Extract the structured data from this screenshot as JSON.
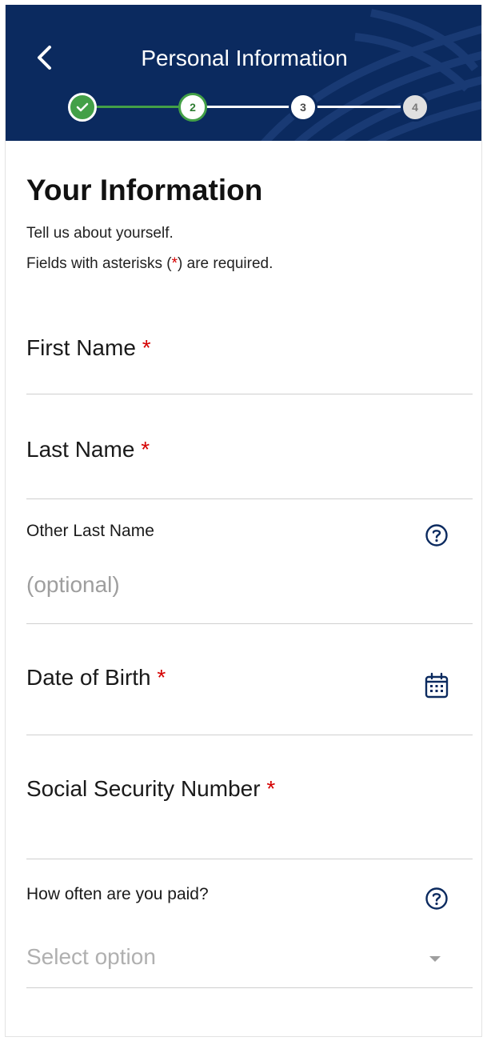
{
  "header": {
    "title": "Personal Information",
    "back_icon": "chevron-left-icon",
    "steps": [
      {
        "label": "",
        "state": "done",
        "icon": "check-icon"
      },
      {
        "label": "2",
        "state": "current"
      },
      {
        "label": "3",
        "state": "upcoming"
      },
      {
        "label": "4",
        "state": "upcoming"
      }
    ],
    "colors": {
      "background": "#0b2a5f",
      "complete": "#43a047"
    }
  },
  "section": {
    "title": "Your Information",
    "intro_line1": "Tell us about yourself.",
    "intro_line2_prefix": "Fields with asterisks (",
    "intro_line2_asterisk": "*",
    "intro_line2_suffix": ") are required."
  },
  "fields": {
    "first_name": {
      "label": "First Name",
      "required_mark": "*",
      "value": ""
    },
    "last_name": {
      "label": "Last Name",
      "required_mark": "*",
      "value": ""
    },
    "other_last_name": {
      "label": "Other Last Name",
      "placeholder": "(optional)",
      "help_icon": "question-circle-icon"
    },
    "date_of_birth": {
      "label": "Date of Birth",
      "required_mark": "*",
      "icon": "calendar-icon"
    },
    "ssn": {
      "label": "Social Security Number",
      "required_mark": "*",
      "value": ""
    },
    "pay_frequency": {
      "label": "How often are you paid?",
      "placeholder": "Select option",
      "help_icon": "question-circle-icon",
      "caret_icon": "caret-down-icon"
    }
  },
  "colors": {
    "required": "#d50000",
    "placeholder": "#9e9e9e",
    "divider": "#cfcfcf",
    "icon": "#0b2a5f"
  }
}
